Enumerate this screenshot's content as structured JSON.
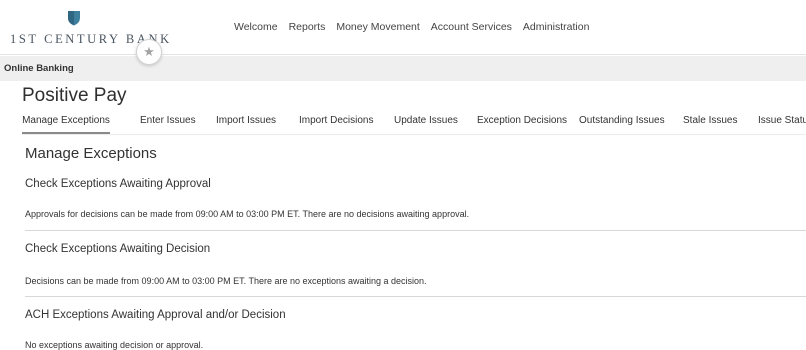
{
  "brand": {
    "name": "1st Century Bank"
  },
  "top_nav": [
    "Welcome",
    "Reports",
    "Money Movement",
    "Account Services",
    "Administration"
  ],
  "subbar": {
    "label": "Online Banking"
  },
  "page": {
    "title": "Positive Pay"
  },
  "tabs": [
    {
      "label": "Manage Exceptions",
      "active": true
    },
    {
      "label": "Enter Issues"
    },
    {
      "label": "Import Issues"
    },
    {
      "label": "Import Decisions"
    },
    {
      "label": "Update Issues"
    },
    {
      "label": "Exception Decisions"
    },
    {
      "label": "Outstanding Issues"
    },
    {
      "label": "Stale Issues"
    },
    {
      "label": "Issue Status"
    }
  ],
  "main": {
    "section_title": "Manage Exceptions",
    "sections": [
      {
        "heading": "Check Exceptions Awaiting Approval",
        "text": "Approvals for decisions can be made from 09:00 AM to 03:00 PM ET. There are no decisions awaiting approval."
      },
      {
        "heading": "Check Exceptions Awaiting Decision",
        "text": "Decisions can be made from 09:00 AM to 03:00 PM ET. There are no exceptions awaiting a decision."
      },
      {
        "heading": "ACH Exceptions Awaiting Approval and/or Decision",
        "text": "No exceptions awaiting decision or approval."
      }
    ]
  },
  "colors": {
    "logo_shield": "#3e7f9e",
    "active_tab_underline": "#8a8a8a",
    "subbar_bg": "#efefef"
  },
  "icons": {
    "logo": "shield-logo-icon",
    "favorite": "star-icon"
  }
}
